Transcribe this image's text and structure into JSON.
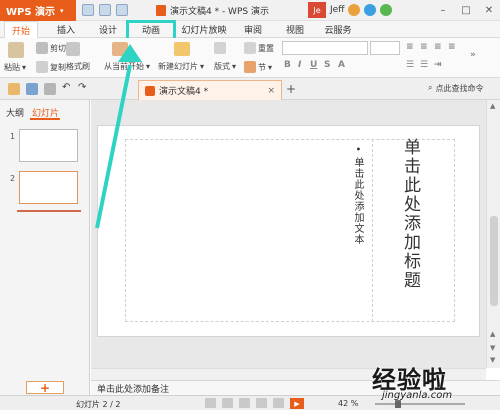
{
  "app": {
    "brand": "WPS 演示",
    "doc_title": "演示文稿4 * - WPS 演示",
    "user": "Jeff"
  },
  "tabs": [
    {
      "label": "开始"
    },
    {
      "label": "插入"
    },
    {
      "label": "设计"
    },
    {
      "label": "动画"
    },
    {
      "label": "幻灯片放映"
    },
    {
      "label": "审阅"
    },
    {
      "label": "视图"
    },
    {
      "label": "云服务"
    }
  ],
  "ribbon": {
    "paste": "粘贴",
    "cut": "剪切",
    "copy": "复制",
    "format_painter": "格式刷",
    "from_current": "从当前开始",
    "new_slide": "新建幻灯片",
    "layout": "版式",
    "section": "节",
    "reset": "重置"
  },
  "docstrip": {
    "doc_tab": "演示文稿4 *",
    "search_cmd": "点此查找命令"
  },
  "leftpanel": {
    "tab_outline": "大纲",
    "tab_slides": "幻灯片",
    "slide_nums": [
      "1",
      "2"
    ],
    "add": "+"
  },
  "slide": {
    "body_placeholder": "单击此处添加文本",
    "title_placeholder": "单击此处添加标题"
  },
  "notes": "单击此处添加备注",
  "statusbar": {
    "slide_info": "幻灯片 2 / 2",
    "zoom": "42 %"
  },
  "watermark": {
    "main": "经验啦",
    "sub": "jingyanla.com"
  },
  "colors": {
    "brand": "#e85d1a",
    "highlight": "#2fd3c3"
  }
}
